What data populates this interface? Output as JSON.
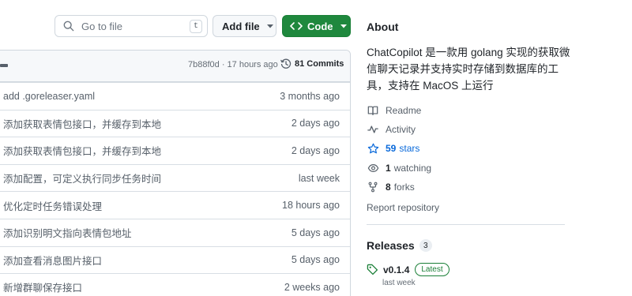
{
  "toolbar": {
    "search_placeholder": "Go to file",
    "search_shortcut": "t",
    "add_file_label": "Add file",
    "code_label": "Code"
  },
  "files": {
    "latest_commit_meta": "7b88f0d · 17 hours ago",
    "commits_label": "81 Commits",
    "rows": [
      {
        "message": "add .goreleaser.yaml",
        "time": "3 months ago"
      },
      {
        "message": "添加获取表情包接口，并缓存到本地",
        "time": "2 days ago"
      },
      {
        "message": "添加获取表情包接口，并缓存到本地",
        "time": "2 days ago"
      },
      {
        "message": "添加配置，可定义执行同步任务时间",
        "time": "last week"
      },
      {
        "message": "优化定时任务错误处理",
        "time": "18 hours ago"
      },
      {
        "message": "添加识别明文指向表情包地址",
        "time": "5 days ago"
      },
      {
        "message": "添加查看消息图片接口",
        "time": "5 days ago"
      },
      {
        "message": "新增群聊保存接口",
        "time": "2 weeks ago"
      }
    ]
  },
  "about": {
    "title": "About",
    "description": "ChatCopilot 是一款用 golang 实现的获取微信聊天记录并支持实时存储到数据库的工具，支持在 MacOS 上运行",
    "readme_label": "Readme",
    "activity_label": "Activity",
    "stars_count": "59",
    "stars_label": "stars",
    "watching_count": "1",
    "watching_label": "watching",
    "forks_count": "8",
    "forks_label": "forks",
    "report_label": "Report repository"
  },
  "releases": {
    "title": "Releases",
    "count": "3",
    "version": "v0.1.4",
    "badge": "Latest",
    "date": "last week"
  },
  "colors": {
    "code_button": "#1f883d",
    "latest_badge": "#1a7f37",
    "link_blue": "#0969da"
  }
}
